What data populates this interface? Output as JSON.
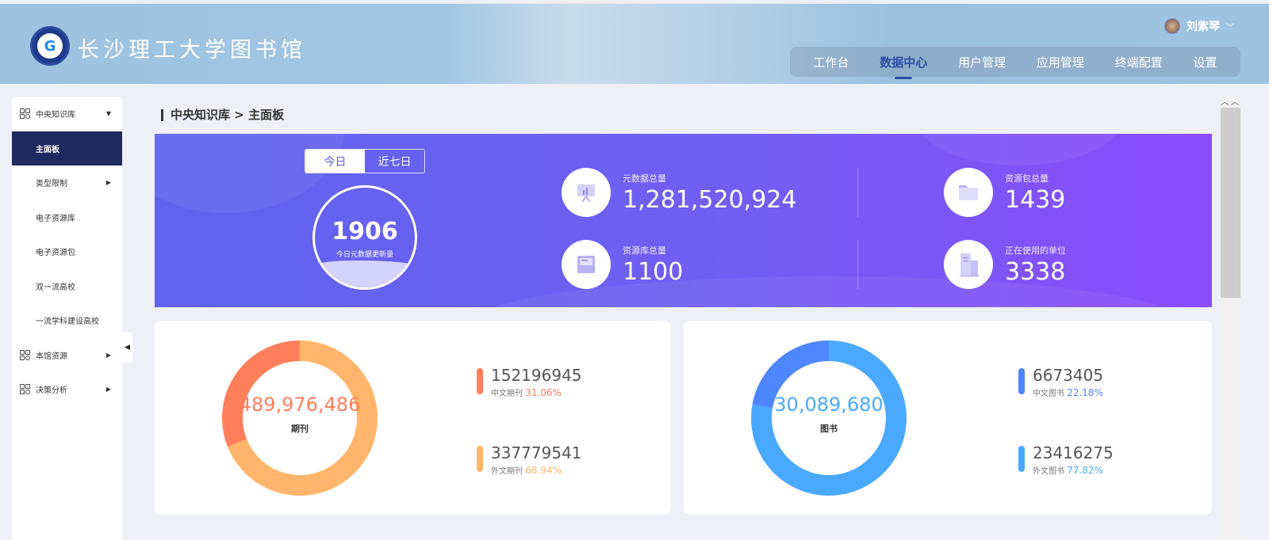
{
  "header": {
    "logo_text": "长沙理工大学图书馆",
    "user_name": "刘紫琴",
    "nav": [
      {
        "label": "工作台"
      },
      {
        "label": "数据中心",
        "active": true
      },
      {
        "label": "用户管理"
      },
      {
        "label": "应用管理"
      },
      {
        "label": "终端配置"
      },
      {
        "label": "设置"
      }
    ]
  },
  "sidebar": {
    "groups": [
      {
        "label": "中央知识库",
        "items": [
          {
            "label": "主面板"
          },
          {
            "label": "类型限制"
          },
          {
            "label": "电子资源库"
          },
          {
            "label": "电子资源包"
          },
          {
            "label": "双一流高校"
          },
          {
            "label": "一流学科建设高校"
          }
        ]
      },
      {
        "label": "本馆资源"
      },
      {
        "label": "决策分析"
      }
    ]
  },
  "breadcrumb": {
    "parent": "中央知识库",
    "sep": ">",
    "current": "主面板"
  },
  "banner": {
    "tabs": [
      "今日",
      "近七日"
    ],
    "today_count": "1906",
    "today_label": "今日元数据更新量",
    "stats": [
      {
        "label": "元数据总量",
        "value": "1,281,520,924"
      },
      {
        "label": "资源包总量",
        "value": "1439"
      },
      {
        "label": "资源库总量",
        "value": "1100"
      },
      {
        "label": "正在使用的单位",
        "value": "3338"
      }
    ]
  },
  "chart_data": [
    {
      "type": "pie",
      "title": "期刊",
      "total": "489,976,486",
      "series": [
        {
          "name": "中文期刊",
          "value": 152196945,
          "percent": "31.06%",
          "color": "#ff7f5c"
        },
        {
          "name": "外文期刊",
          "value": 337779541,
          "percent": "68.94%",
          "color": "#ffb56b"
        }
      ]
    },
    {
      "type": "pie",
      "title": "图书",
      "total": "30,089,680",
      "series": [
        {
          "name": "中文图书",
          "value": 6673405,
          "percent": "22.18%",
          "color": "#4e86ff"
        },
        {
          "name": "外文图书",
          "value": 23416275,
          "percent": "77.82%",
          "color": "#4aa9ff"
        }
      ]
    }
  ]
}
